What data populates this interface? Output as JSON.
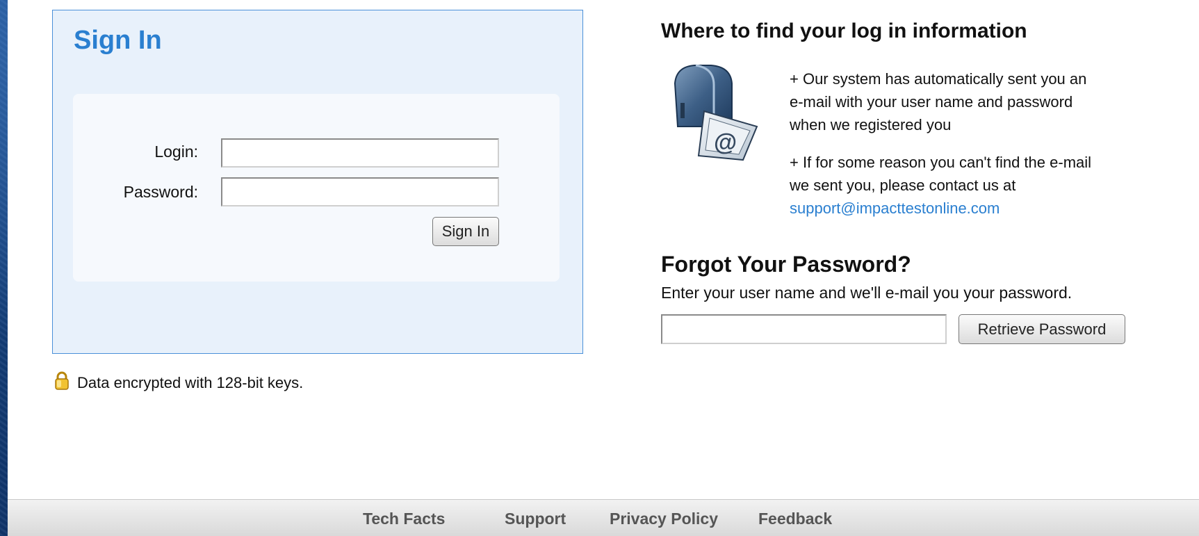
{
  "signin": {
    "title": "Sign In",
    "login_label": "Login:",
    "login_value": "",
    "password_label": "Password:",
    "password_value": "",
    "button_label": "Sign In"
  },
  "security": {
    "icon": "lock-icon",
    "text": "Data encrypted with 128-bit keys."
  },
  "info": {
    "heading": "Where to find your log in information",
    "icon": "mailbox-icon",
    "para1": "+ Our system has automatically sent you an e-mail with your user name and password when we registered you",
    "para2_prefix": "+ If for some reason you can't find the e-mail we sent you, please contact us at",
    "support_email": "support@impacttestonline.com"
  },
  "forgot": {
    "heading": "Forgot Your Password?",
    "description": "Enter your user name and we'll e-mail you your password.",
    "input_value": "",
    "button_label": "Retrieve Password"
  },
  "footer": {
    "links": [
      "Tech Facts",
      "Support",
      "Privacy Policy",
      "Feedback"
    ]
  },
  "colors": {
    "accent": "#2a7fd0",
    "panel_background": "#e8f1fb",
    "panel_border": "#4a90d9",
    "page_background": "#143a72"
  }
}
